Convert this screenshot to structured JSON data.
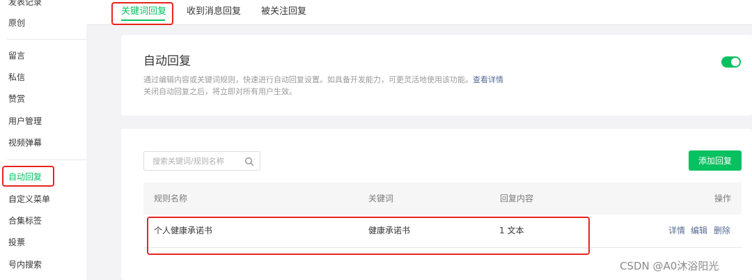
{
  "sidebar": {
    "items": [
      {
        "label": "发表记录",
        "active": false
      },
      {
        "label": "原创",
        "active": false
      },
      {
        "label": "留言",
        "active": false
      },
      {
        "label": "私信",
        "active": false
      },
      {
        "label": "赞赏",
        "active": false
      },
      {
        "label": "用户管理",
        "active": false
      },
      {
        "label": "视频弹幕",
        "active": false
      },
      {
        "label": "自动回复",
        "active": true
      },
      {
        "label": "自定义菜单",
        "active": false
      },
      {
        "label": "合集标签",
        "active": false
      },
      {
        "label": "投票",
        "active": false
      },
      {
        "label": "号内搜索",
        "active": false
      }
    ]
  },
  "tabs": [
    {
      "label": "关键词回复",
      "active": true
    },
    {
      "label": "收到消息回复",
      "active": false
    },
    {
      "label": "被关注回复",
      "active": false
    }
  ],
  "auto_reply": {
    "title": "自动回复",
    "desc_line1": "通过编辑内容或关键词规则，快速进行自动回复设置。如具备开发能力，可更灵活地使用该功能。",
    "desc_link": "查看详情",
    "desc_line2": "关闭自动回复之后，将立即对所有用户生效。",
    "enabled": true
  },
  "rules": {
    "search_placeholder": "搜索关键词/规则名称",
    "search_value": "",
    "add_button": "添加回复",
    "columns": {
      "name": "规则名称",
      "keyword": "关键词",
      "content": "回复内容",
      "actions": "操作"
    },
    "rows": [
      {
        "name": "个人健康承诺书",
        "keyword": "健康承诺书",
        "content": "1 文本",
        "actions": [
          "详情",
          "编辑",
          "删除"
        ]
      }
    ]
  },
  "colors": {
    "accent": "#07c160",
    "highlight_box": "#e8231d",
    "link": "#576b95"
  },
  "watermark": "CSDN @A0沐浴阳光"
}
